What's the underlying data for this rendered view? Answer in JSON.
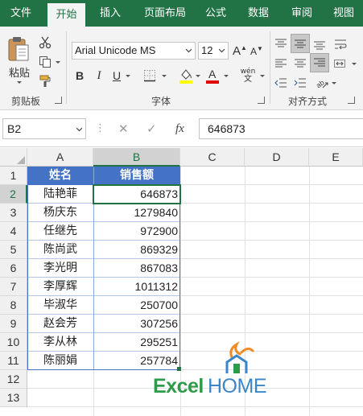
{
  "ribbon_tabs": [
    "文件",
    "开始",
    "插入",
    "页面布局",
    "公式",
    "数据",
    "审阅",
    "视图"
  ],
  "clipboard": {
    "paste_label": "粘贴",
    "group_label": "剪贴板"
  },
  "font": {
    "name": "Arial Unicode MS",
    "size": "12",
    "bold": "B",
    "italic": "I",
    "underline": "U",
    "phonetic": "wén",
    "group_label": "字体"
  },
  "alignment": {
    "group_label": "对齐方式"
  },
  "formula_bar": {
    "name_box": "B2",
    "fx": "fx",
    "value": "646873"
  },
  "columns": [
    "A",
    "B",
    "C",
    "D",
    "E"
  ],
  "rows": [
    "1",
    "2",
    "3",
    "4",
    "5",
    "6",
    "7",
    "8",
    "9",
    "10",
    "11",
    "12",
    "13"
  ],
  "table": {
    "headers": [
      "姓名",
      "销售额"
    ],
    "records": [
      [
        "陆艳菲",
        "646873"
      ],
      [
        "杨庆东",
        "1279840"
      ],
      [
        "任继先",
        "972900"
      ],
      [
        "陈尚武",
        "869329"
      ],
      [
        "李光明",
        "867083"
      ],
      [
        "李厚辉",
        "1011312"
      ],
      [
        "毕淑华",
        "250700"
      ],
      [
        "赵会芳",
        "307256"
      ],
      [
        "李从林",
        "295251"
      ],
      [
        "陈丽娟",
        "257784"
      ]
    ]
  },
  "selection": {
    "cell": "B2",
    "column": "B",
    "row": "2"
  },
  "watermark": {
    "left": "Excel",
    "right": "HOME"
  },
  "colors": {
    "accent": "#217346",
    "table_header": "#4472c4",
    "logo_green": "#2e9b4a",
    "logo_blue": "#3b86c8",
    "logo_orange": "#f08a24"
  }
}
